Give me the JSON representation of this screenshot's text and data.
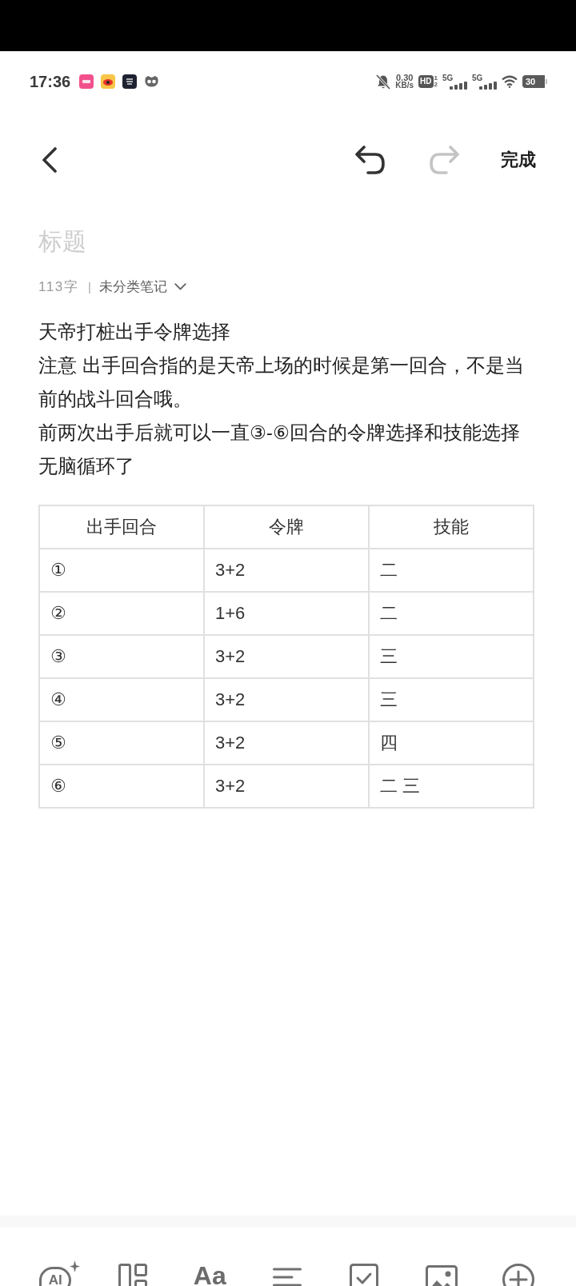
{
  "status_bar": {
    "time": "17:36",
    "network_speed": {
      "value": "0.30",
      "unit": "KB/s"
    },
    "hd_badge": {
      "label": "HD",
      "sims": [
        "1",
        "2"
      ]
    },
    "signals": [
      {
        "label": "5G"
      },
      {
        "label": "5G"
      }
    ],
    "battery": {
      "label": "30"
    }
  },
  "toolbar": {
    "undo": {
      "disabled": false
    },
    "redo": {
      "disabled": true
    },
    "done": "完成"
  },
  "note": {
    "title": {
      "placeholder": "标题"
    },
    "word_count": "113字",
    "separator": "|",
    "folder": "未分类笔记",
    "paragraphs": [
      "天帝打桩出手令牌选择",
      "注意 出手回合指的是天帝上场的时候是第一回合，不是当前的战斗回合哦。",
      "前两次出手后就可以一直③-⑥回合的令牌选择和技能选择无脑循环了"
    ]
  },
  "table": {
    "columns": [
      "出手回合",
      "令牌",
      "技能"
    ],
    "rows": [
      [
        "①",
        "3+2",
        "二"
      ],
      [
        "②",
        "1+6",
        "二"
      ],
      [
        "③",
        "3+2",
        "三"
      ],
      [
        "④",
        "3+2",
        "三"
      ],
      [
        "⑤",
        "3+2",
        "四"
      ],
      [
        "⑥",
        "3+2",
        "二 三"
      ]
    ]
  },
  "bottom_toolbar": {
    "items": [
      {
        "kind": "ai",
        "label": "AI"
      },
      {
        "kind": "layout"
      },
      {
        "kind": "text_format",
        "label": "Aa"
      },
      {
        "kind": "align"
      },
      {
        "kind": "checklist"
      },
      {
        "kind": "image"
      },
      {
        "kind": "add"
      }
    ]
  }
}
